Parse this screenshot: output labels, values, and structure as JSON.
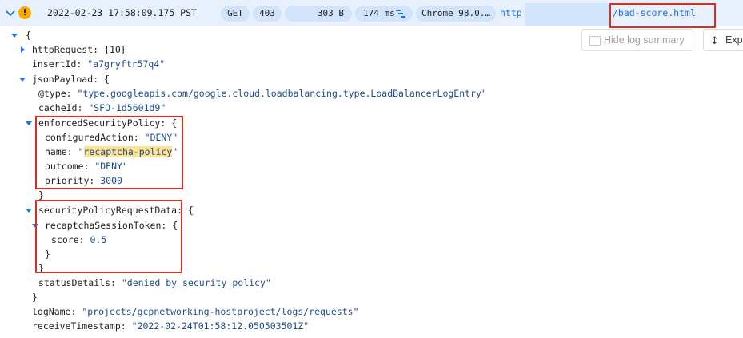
{
  "header": {
    "timestamp": "2022-02-23 17:58:09.175 PST",
    "method": "GET",
    "status": "403",
    "size": "303 B",
    "latency": "174 ms",
    "user_agent": "Chrome 98.0.…",
    "url_prefix": "http",
    "url_suffix": "/bad-score.html"
  },
  "actions": {
    "hide_summary": "Hide log summary",
    "expand": "Expa"
  },
  "log": {
    "open_brace": "{",
    "httpRequest_key": "httpRequest:",
    "httpRequest_val": "{10}",
    "insertId_key": "insertId:",
    "insertId_val": "\"a7gryftr57q4\"",
    "jsonPayload_key": "jsonPayload:",
    "brace_open": "{",
    "type_key": "@type:",
    "type_val": "\"type.googleapis.com/google.cloud.loadbalancing.type.LoadBalancerLogEntry\"",
    "cacheId_key": "cacheId:",
    "cacheId_val": "\"SFO-1d5601d9\"",
    "esp_key": "enforcedSecurityPolicy:",
    "configuredAction_key": "configuredAction:",
    "configuredAction_val": "\"DENY\"",
    "name_key": "name:",
    "name_q": "\"",
    "name_val": "recaptcha-policy",
    "outcome_key": "outcome:",
    "outcome_val": "\"DENY\"",
    "priority_key": "priority:",
    "priority_val": "3000",
    "close_brace": "}",
    "sprd_key": "securityPolicyRequestData:",
    "rst_key": "recaptchaSessionToken:",
    "score_key": "score:",
    "score_val": "0.5",
    "statusDetails_key": "statusDetails:",
    "statusDetails_val": "\"denied_by_security_policy\"",
    "logName_key": "logName:",
    "logName_val": "\"projects/gcpnetworking-hostproject/logs/requests\"",
    "receiveTimestamp_key": "receiveTimestamp:",
    "receiveTimestamp_val": "\"2022-02-24T01:58:12.050503501Z\""
  },
  "colors": {
    "header_bg": "#e8f0fe",
    "chip_bg": "#d2e3fc",
    "warning": "#f9ab00",
    "highlight_box": "#d93025",
    "string_value": "#1c4a8f",
    "link": "#1a73e8"
  }
}
